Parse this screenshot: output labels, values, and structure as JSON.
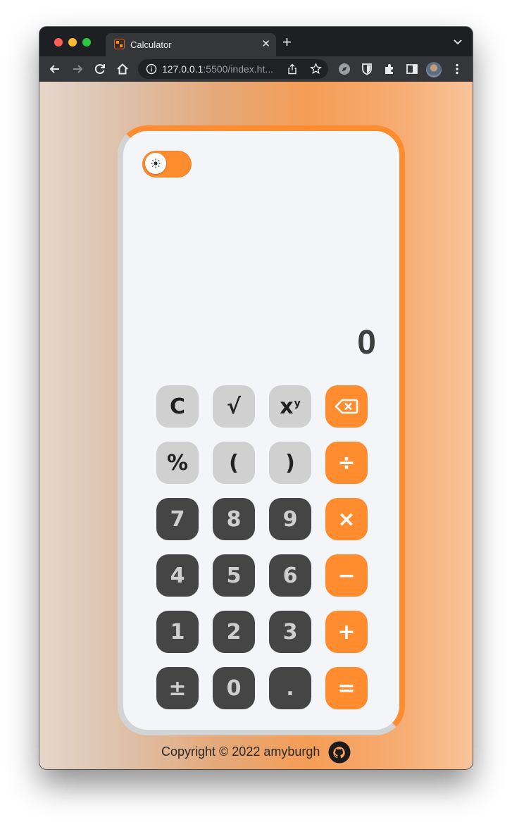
{
  "browser": {
    "tab": {
      "title": "Calculator",
      "close_glyph": "✕"
    },
    "new_tab_glyph": "+",
    "url_host": "127.0.0.1",
    "url_rest": ":5500/index.ht..."
  },
  "calculator": {
    "display": "0",
    "theme_toggle": {
      "icon": "sun-icon",
      "accent": "#ff8c2e"
    },
    "keys": [
      [
        "C",
        "√",
        "xy",
        "backspace"
      ],
      [
        "%",
        "(",
        ")",
        "÷"
      ],
      [
        "7",
        "8",
        "9",
        "×"
      ],
      [
        "4",
        "5",
        "6",
        "−"
      ],
      [
        "1",
        "2",
        "3",
        "+"
      ],
      [
        "±",
        "0",
        ".",
        "="
      ]
    ],
    "labels": {
      "clear": "C",
      "sqrt": "√",
      "power_base": "x",
      "power_exp": "y",
      "percent": "%",
      "open_paren": "(",
      "close_paren": ")",
      "divide": "÷",
      "seven": "7",
      "eight": "8",
      "nine": "9",
      "multiply": "×",
      "four": "4",
      "five": "5",
      "six": "6",
      "minus": "−",
      "one": "1",
      "two": "2",
      "three": "3",
      "plus": "+",
      "plus_minus": "±",
      "zero": "0",
      "decimal": ".",
      "equals": "="
    }
  },
  "footer": {
    "text": "Copyright © 2022 amyburgh",
    "icon": "github-icon"
  },
  "colors": {
    "accent": "#ff8c2e",
    "function_key": "#d0d0d0",
    "number_key": "#454545",
    "panel": "#f4f5f8"
  }
}
